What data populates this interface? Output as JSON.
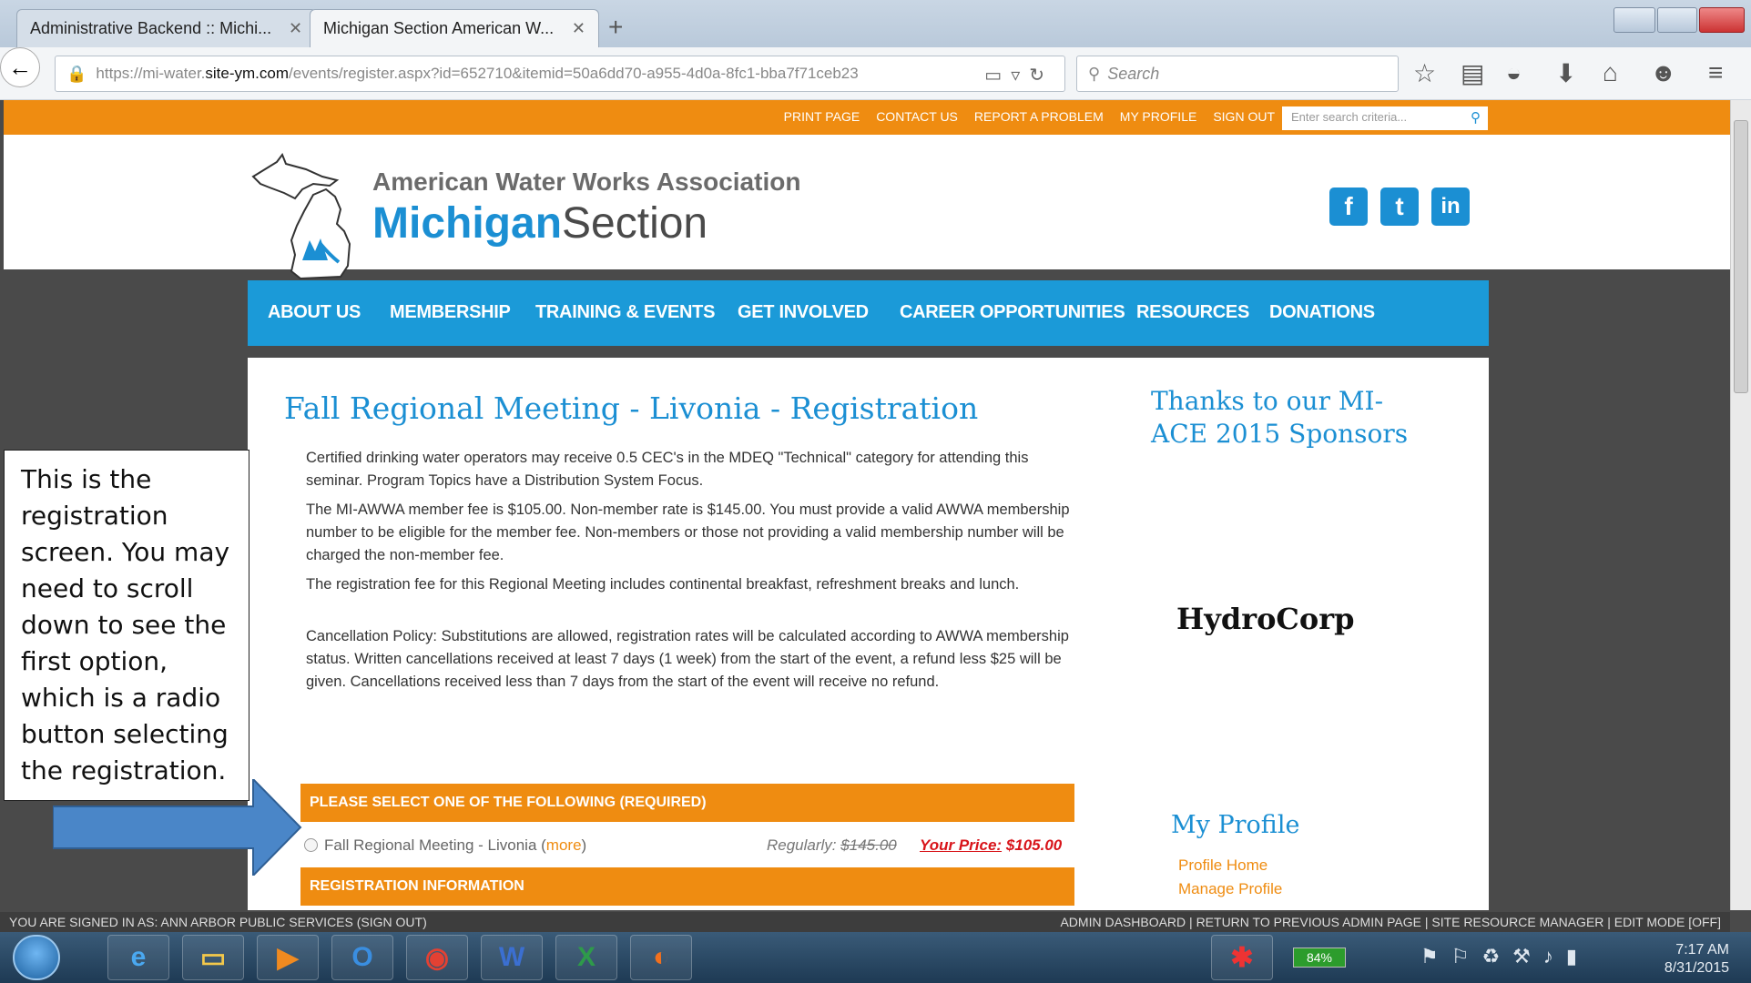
{
  "browser": {
    "tabs": [
      {
        "title": "Administrative Backend :: Michi...",
        "active": false
      },
      {
        "title": "Michigan Section American W...",
        "active": true
      }
    ],
    "url_prefix": "https://mi-water.",
    "url_domain": "site-ym.com",
    "url_rest": "/events/register.aspx?id=652710&itemid=50a6dd70-a955-4d0a-8fc1-bba7f71ceb23",
    "search_placeholder": "Search"
  },
  "site": {
    "top_links": [
      "PRINT PAGE",
      "CONTACT US",
      "REPORT A PROBLEM",
      "MY PROFILE",
      "SIGN OUT"
    ],
    "top_search_placeholder": "Enter search criteria...",
    "org_name": "American Water Works Association",
    "section_bold": "Michigan",
    "section_rest": "Section",
    "social": {
      "facebook": "f",
      "twitter": "t",
      "linkedin": "in"
    },
    "main_nav": [
      "ABOUT US",
      "MEMBERSHIP",
      "TRAINING & EVENTS",
      "GET INVOLVED",
      "CAREER OPPORTUNITIES",
      "RESOURCES",
      "DONATIONS"
    ]
  },
  "main": {
    "heading": "Fall Regional Meeting - Livonia - Registration",
    "paragraphs": [
      "Certified drinking water operators may receive 0.5 CEC's in the MDEQ \"Technical\" category for attending this seminar. Program Topics have a Distribution System Focus.",
      "The MI-AWWA member fee is $105.00.  Non-member rate is $145.00.  You must provide a valid AWWA membership number to be eligible for the member fee.  Non-members or those not providing a valid membership number will be charged the non-member fee.",
      "The registration fee for this Regional Meeting includes continental breakfast, refreshment breaks and lunch.",
      "Cancellation Policy: Substitutions are allowed, registration rates will be calculated according to AWWA membership status.  Written cancellations received at least 7 days (1 week) from the start of the event, a refund less $25 will be given. Cancellations received less than 7 days from the start of the event will receive no refund."
    ],
    "select_header": "PLEASE SELECT ONE OF THE FOLLOWING (REQUIRED)",
    "option": {
      "label": "Fall Regional Meeting - Livonia",
      "more_link": "more",
      "regular_label": "Regularly:",
      "regular_price": "$145.00",
      "your_price_label": "Your Price:",
      "your_price": "$105.00"
    },
    "reg_info_header": "REGISTRATION INFORMATION"
  },
  "sidebar": {
    "sponsors_heading": "Thanks to our MI-ACE 2015 Sponsors",
    "sponsor_name": "HydroCorp",
    "profile_heading": "My Profile",
    "profile_links": [
      "Profile Home",
      "Manage Profile"
    ]
  },
  "admin_bar": {
    "left": "YOU ARE SIGNED IN AS: ANN ARBOR PUBLIC SERVICES (SIGN OUT)",
    "right": "ADMIN DASHBOARD | RETURN TO PREVIOUS ADMIN PAGE | SITE RESOURCE MANAGER | EDIT MODE [OFF]"
  },
  "annotation": {
    "text": "This is the registration screen. You may need to scroll down to see the first option, which is a radio button selecting the registration."
  },
  "taskbar": {
    "battery": "84%",
    "time": "7:17 AM",
    "date": "8/31/2015"
  },
  "colors": {
    "orange": "#ef8c11",
    "blue": "#1b9ad8",
    "price_red": "#d8141a"
  }
}
